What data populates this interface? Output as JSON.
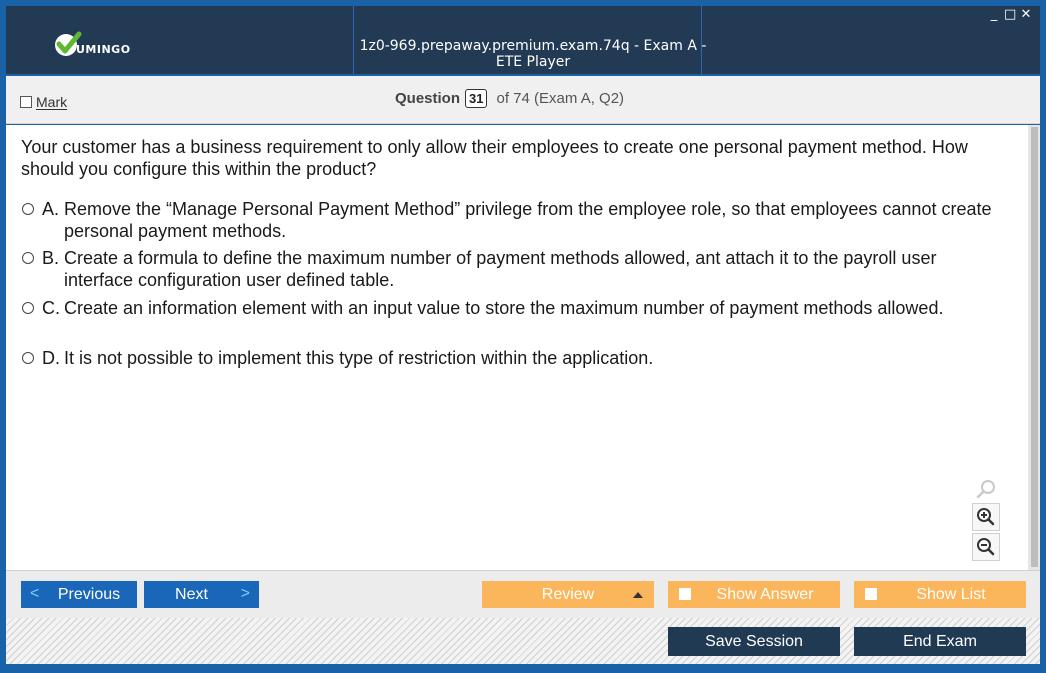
{
  "window": {
    "title": "1z0-969.prepaway.premium.exam.74q - Exam A - ETE Player",
    "logo_text": "UMINGO",
    "controls": [
      "_",
      "□",
      "✕"
    ]
  },
  "header": {
    "mark_label": "Mark",
    "question_label": "Question",
    "question_number": "31",
    "of_text": "of 74 (Exam A, Q2)"
  },
  "question": {
    "text": "Your customer has a business requirement to only allow their employees to create one personal payment method. How should you configure this within the product?",
    "options": [
      {
        "letter": "A.",
        "text": "Remove the “Manage Personal Payment Method” privilege from the employee role, so that employees cannot create personal payment methods."
      },
      {
        "letter": "B.",
        "text": "Create a formula to define the maximum number of payment methods allowed, ant attach it to the payroll user interface configuration user defined table."
      },
      {
        "letter": "C.",
        "text": "Create an information element with an input value to store the maximum number of payment methods allowed."
      },
      {
        "letter": "D.",
        "text": "It is not possible to implement this type of restriction within the application."
      }
    ]
  },
  "zoom_icons": [
    "magnifier-icon",
    "zoom-in-icon",
    "zoom-out-icon"
  ],
  "nav": {
    "previous_label": "Previous",
    "next_label": "Next",
    "review_label": "Review",
    "show_answer_label": "Show Answer",
    "show_list_label": "Show List"
  },
  "footer": {
    "save_session_label": "Save Session",
    "end_exam_label": "End Exam"
  },
  "colors": {
    "titlebar": "#233a55",
    "primary_button": "#1a66b8",
    "accent_button": "#fbb55a",
    "dark_button": "#203a54",
    "logo_check": "#5fb830"
  }
}
